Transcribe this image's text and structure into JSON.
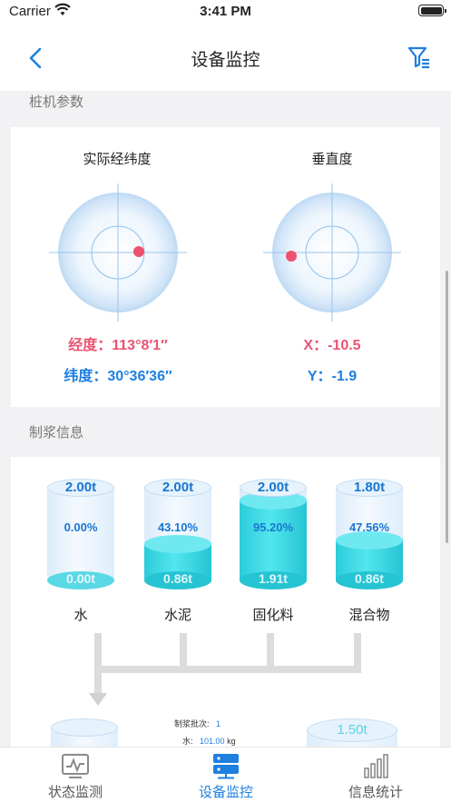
{
  "status_bar": {
    "carrier": "Carrier",
    "time": "3:41 PM"
  },
  "nav": {
    "title": "设备监控"
  },
  "pile_params": {
    "section_title": "桩机参数",
    "gps_gauge": {
      "title": "实际经纬度",
      "longitude": "经度：113°8′1″",
      "latitude": "纬度：30°36′36″"
    },
    "vertical_gauge": {
      "title": "垂直度",
      "x": "X：-10.5",
      "y": "Y：-1.9"
    }
  },
  "slurry": {
    "section_title": "制浆信息",
    "tanks": [
      {
        "name": "水",
        "capacity": "2.00t",
        "percent": "0.00%",
        "amount": "0.00t",
        "level": 0.0
      },
      {
        "name": "水泥",
        "capacity": "2.00t",
        "percent": "43.10%",
        "amount": "0.86t",
        "level": 0.431
      },
      {
        "name": "固化料",
        "capacity": "2.00t",
        "percent": "95.20%",
        "amount": "1.91t",
        "level": 0.952
      },
      {
        "name": "混合物",
        "capacity": "1.80t",
        "percent": "47.56%",
        "amount": "0.86t",
        "level": 0.4756
      }
    ],
    "batch": {
      "batch_label": "制浆批次:",
      "batch_value": "1",
      "water_label": "水:",
      "water_value": "101.00",
      "water_unit": "kg"
    },
    "output_tank_capacity": "1.50t"
  },
  "tabs": [
    {
      "label": "状态监测",
      "icon": "monitor-chart-icon",
      "active": false
    },
    {
      "label": "设备监控",
      "icon": "server-icon",
      "active": true
    },
    {
      "label": "信息统计",
      "icon": "bar-chart-icon",
      "active": false
    }
  ],
  "colors": {
    "accent": "#1d7fe0",
    "red": "#ec5270",
    "cyan": "#2ccbd9"
  }
}
